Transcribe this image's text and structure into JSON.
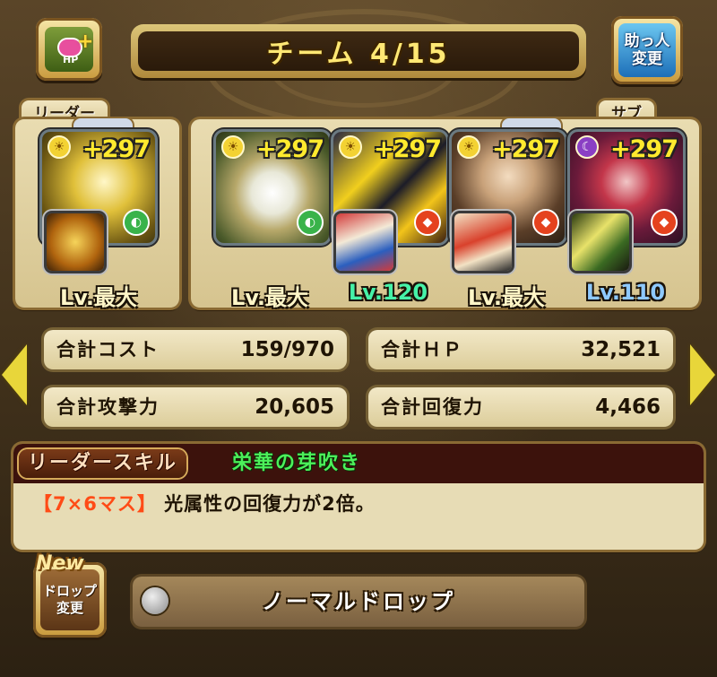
{
  "header": {
    "title": "チーム 4/15",
    "hp_button_icon": "plus-hp-icon",
    "hp_button_label": "HP",
    "helper_button_line1": "助っ人",
    "helper_button_line2": "変更"
  },
  "team": {
    "leader_tab": "リーダー",
    "sub_tab": "サブ",
    "members": [
      {
        "role": "leader",
        "plus": "+297",
        "level": "Lv.最大",
        "level_color": "#fff6c8",
        "attribute": "light",
        "sub_attribute": "wood",
        "has_assist": true
      },
      {
        "role": "sub",
        "plus": "+297",
        "level": "Lv.最大",
        "level_color": "#fff6c8",
        "attribute": "light",
        "sub_attribute": "wood",
        "has_assist": false
      },
      {
        "role": "sub",
        "plus": "+297",
        "level": "Lv.120",
        "level_color": "#46f2a8",
        "attribute": "light",
        "sub_attribute": "fire",
        "has_assist": true
      },
      {
        "role": "sub",
        "plus": "+297",
        "level": "Lv.最大",
        "level_color": "#fff6c8",
        "attribute": "light",
        "sub_attribute": "fire",
        "has_assist": true
      },
      {
        "role": "sub",
        "plus": "+297",
        "level": "Lv.110",
        "level_color": "#8ec9ff",
        "attribute": "dark",
        "sub_attribute": "fire",
        "has_assist": true
      }
    ]
  },
  "stats": {
    "total_cost_label": "合計コスト",
    "total_cost_value": "159/970",
    "total_hp_label": "合計ＨＰ",
    "total_hp_value": "32,521",
    "total_attack_label": "合計攻撃力",
    "total_attack_value": "20,605",
    "total_recovery_label": "合計回復力",
    "total_recovery_value": "4,466"
  },
  "leader_skill": {
    "badge": "リーダースキル",
    "name": "栄華の芽吹き",
    "board": "【7×6マス】",
    "description": "光属性の回復力が2倍。"
  },
  "drop": {
    "new_tag": "New",
    "button_line1": "ドロップ",
    "button_line2": "変更",
    "current": "ノーマルドロップ"
  },
  "colors": {
    "light_attr": "#f3d233",
    "dark_attr": "#8a3fc4",
    "wood_attr": "#39b34a",
    "fire_attr": "#e5421e",
    "plus_yellow": "#ffea2e",
    "skill_name_green": "#4cf05a",
    "board_highlight": "#ff4b16"
  }
}
